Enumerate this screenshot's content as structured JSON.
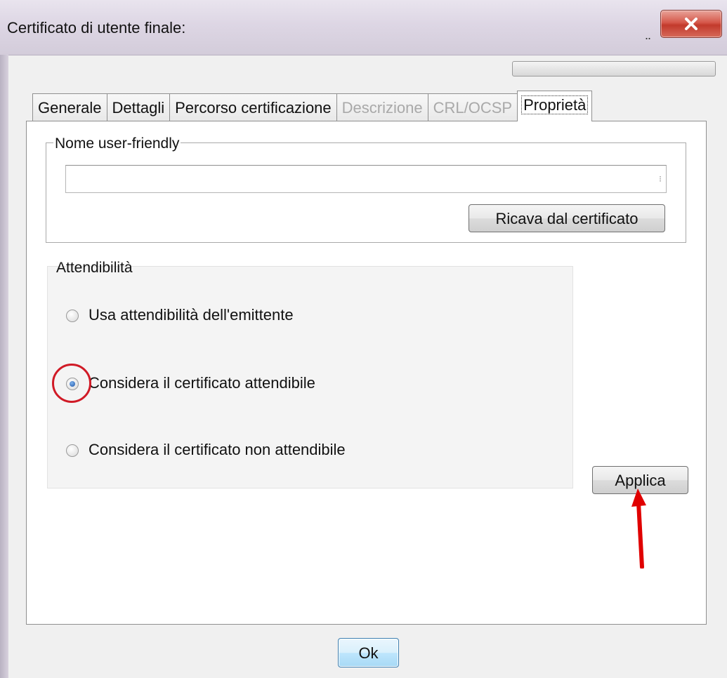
{
  "window": {
    "title": "Certificato di utente finale:",
    "minimize_glyph": "..",
    "close_icon": "close-x-icon"
  },
  "tabs": [
    {
      "label": "Generale",
      "state": "normal"
    },
    {
      "label": "Dettagli",
      "state": "normal"
    },
    {
      "label": "Percorso certificazione",
      "state": "normal"
    },
    {
      "label": "Descrizione",
      "state": "disabled"
    },
    {
      "label": "CRL/OCSP",
      "state": "disabled"
    },
    {
      "label": "Proprietà",
      "state": "selected"
    }
  ],
  "friendly_name": {
    "legend": "Nome user-friendly",
    "value": "",
    "derive_button": "Ricava dal certificato"
  },
  "trust": {
    "legend": "Attendibilità",
    "options": [
      {
        "label": "Usa attendibilità dell'emittente",
        "checked": false
      },
      {
        "label": "Considera il certificato attendibile",
        "checked": true
      },
      {
        "label": "Considera il certificato non attendibile",
        "checked": false
      }
    ]
  },
  "apply_button": "Applica",
  "ok_button": "Ok",
  "colors": {
    "annotation_red": "#d01a26",
    "close_button_red": "#c23a2c",
    "ok_button_blue": "#bee6fd"
  },
  "annotations": {
    "highlight_circle": "red-circle-around-selected-radio",
    "arrow": "red-arrow-pointing-to-applica"
  }
}
